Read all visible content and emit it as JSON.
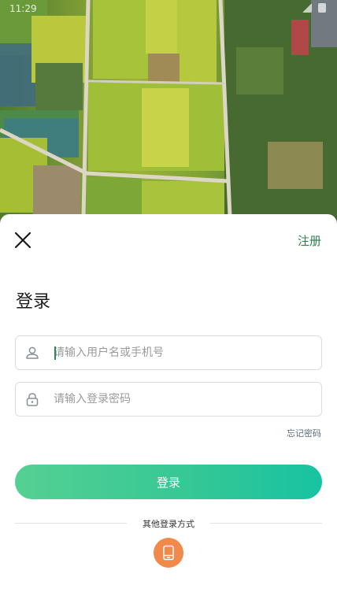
{
  "status_bar": {
    "time": "11:29"
  },
  "header": {
    "register_label": "注册"
  },
  "login": {
    "title": "登录",
    "username_placeholder": "请输入用户名或手机号",
    "password_placeholder": "请输入登录密码",
    "forgot_password_label": "忘记密码",
    "submit_label": "登录",
    "other_methods_label": "其他登录方式"
  },
  "colors": {
    "accent_green": "#2e7d4f",
    "button_gradient_start": "#55d093",
    "button_gradient_end": "#17c3a2",
    "alt_login_orange": "#f0894a"
  },
  "icons": {
    "close": "close-icon",
    "user": "user-icon",
    "lock": "lock-icon",
    "phone": "phone-icon"
  }
}
